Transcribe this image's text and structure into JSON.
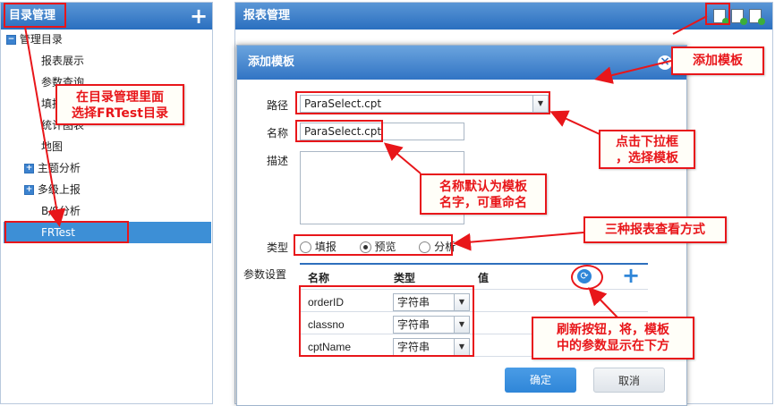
{
  "left_panel": {
    "title": "目录管理",
    "add_icon": "+",
    "tree": [
      {
        "label": "管理目录",
        "icon": "−"
      },
      {
        "label": "报表展示"
      },
      {
        "label": "参数查询"
      },
      {
        "label": "填报"
      },
      {
        "label": "统计图表"
      },
      {
        "label": "地图"
      },
      {
        "label": "主题分析",
        "icon": "+"
      },
      {
        "label": "多级上报",
        "icon": "+"
      },
      {
        "label": "B/S分析"
      },
      {
        "label": "FRTest"
      }
    ]
  },
  "right_panel": {
    "title": "报表管理",
    "icons": [
      "add-template-icon",
      "edit-template-icon",
      "delete-template-icon"
    ]
  },
  "dialog": {
    "title": "添加模板",
    "close": "×",
    "path_label": "路径",
    "path_value": "ParaSelect.cpt",
    "name_label": "名称",
    "name_value": "ParaSelect.cpt",
    "desc_label": "描述",
    "type_label": "类型",
    "types": [
      {
        "label": "填报",
        "checked": false
      },
      {
        "label": "预览",
        "checked": true
      },
      {
        "label": "分析",
        "checked": false
      }
    ],
    "params_label": "参数设置",
    "params_headers": {
      "name": "名称",
      "type": "类型",
      "value": "值"
    },
    "params": [
      {
        "name": "orderID",
        "type": "字符串"
      },
      {
        "name": "classno",
        "type": "字符串"
      },
      {
        "name": "cptName",
        "type": "字符串"
      }
    ],
    "ok": "确定",
    "cancel": "取消"
  },
  "annotations": {
    "select_dir": "在目录管理里面\n选择FRTest目录",
    "add_template": "添加模板",
    "click_dropdown": "点击下拉框\n，选择模板",
    "name_default": "名称默认为模板\n名字，可重命名",
    "three_ways": "三种报表查看方式",
    "refresh": "刷新按钮，将，模板\n中的参数显示在下方"
  },
  "colors": {
    "header": "#3a7dca",
    "accent_red": "#e8161a",
    "selected_row": "#3d8fd6",
    "ok_button": "#2f86d8"
  }
}
